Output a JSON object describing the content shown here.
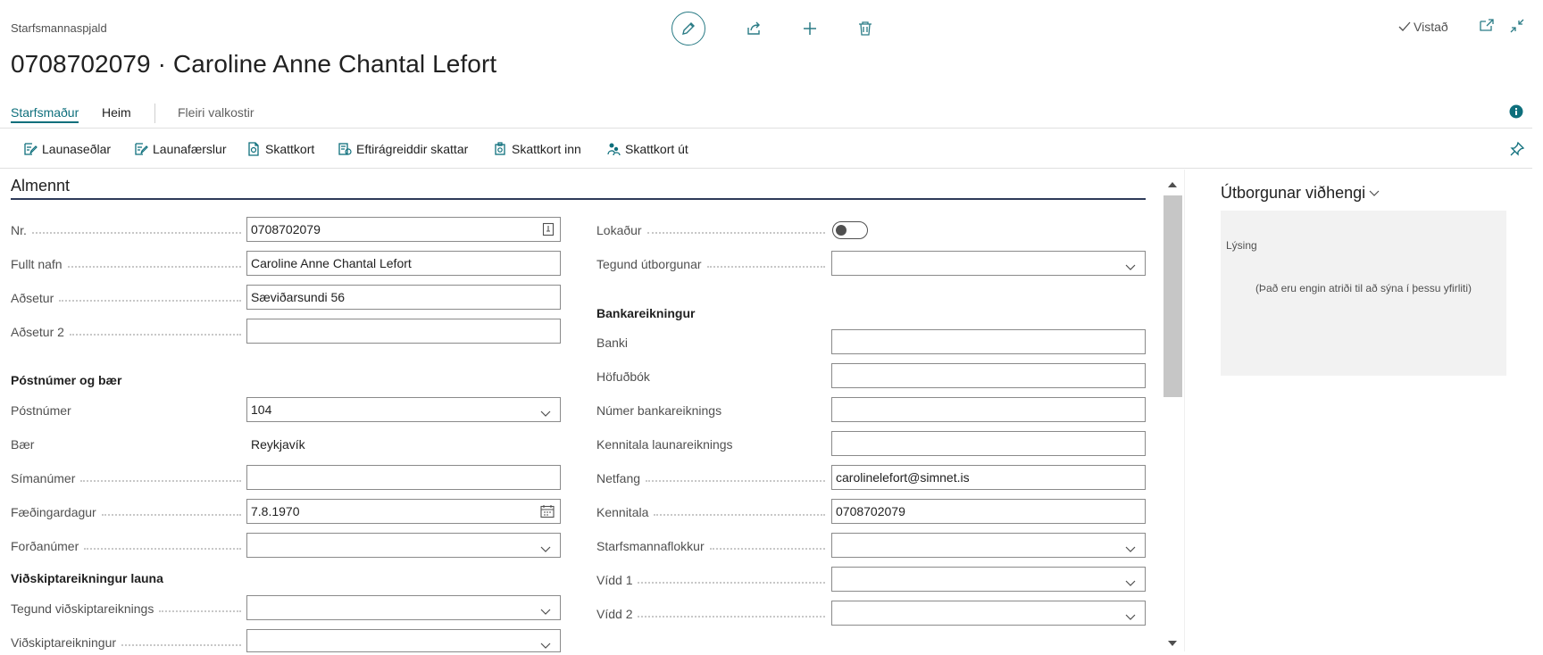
{
  "header": {
    "caption": "Starfsmannaspjald",
    "title": "0708702079 · Caroline Anne Chantal Lefort",
    "saved_label": "Vistað"
  },
  "tabs": [
    {
      "label": "Starfsmaður"
    },
    {
      "label": "Heim"
    },
    {
      "label": "Fleiri valkostir"
    }
  ],
  "actions": [
    {
      "label": "Launaseðlar"
    },
    {
      "label": "Launafærslur"
    },
    {
      "label": "Skattkort"
    },
    {
      "label": "Eftirágreiddir skattar"
    },
    {
      "label": "Skattkort inn"
    },
    {
      "label": "Skattkort út"
    }
  ],
  "section": {
    "title": "Almennt"
  },
  "left_fields": {
    "nr": {
      "label": "Nr.",
      "value": "0708702079"
    },
    "fullt_nafn": {
      "label": "Fullt nafn",
      "value": "Caroline Anne Chantal Lefort"
    },
    "adsetur": {
      "label": "Aðsetur",
      "value": "Sæviðarsundi 56"
    },
    "adsetur2": {
      "label": "Aðsetur 2",
      "value": ""
    },
    "group_postnumer": "Póstnúmer og bær",
    "postnumer": {
      "label": "Póstnúmer",
      "value": "104"
    },
    "baer": {
      "label": "Bær",
      "value": "Reykjavík"
    },
    "simanumer": {
      "label": "Símanúmer",
      "value": ""
    },
    "faedingardagur": {
      "label": "Fæðingardagur",
      "value": "7.8.1970"
    },
    "fordanumer": {
      "label": "Forðanúmer",
      "value": ""
    },
    "group_vidskipta": "Viðskiptareikningur launa",
    "tegund_vidskipta": {
      "label": "Tegund viðskiptareiknings",
      "value": ""
    },
    "vidskiptareikningur": {
      "label": "Viðskiptareikningur",
      "value": ""
    }
  },
  "right_fields": {
    "lokadur": {
      "label": "Lokaður",
      "value": false
    },
    "tegund_utborgunar": {
      "label": "Tegund útborgunar",
      "value": ""
    },
    "group_banka": "Bankareikningur",
    "banki": {
      "label": "Banki",
      "value": ""
    },
    "hofudbok": {
      "label": "Höfuðbók",
      "value": ""
    },
    "numer_banka": {
      "label": "Númer bankareiknings",
      "value": ""
    },
    "kennitala_launa": {
      "label": "Kennitala launareiknings",
      "value": ""
    },
    "netfang": {
      "label": "Netfang",
      "value": "carolinelefort@simnet.is"
    },
    "kennitala": {
      "label": "Kennitala",
      "value": "0708702079"
    },
    "starfsmannaflokkur": {
      "label": "Starfsmannaflokkur",
      "value": ""
    },
    "vidd1": {
      "label": "Vídd 1",
      "value": ""
    },
    "vidd2": {
      "label": "Vídd 2",
      "value": ""
    }
  },
  "factbox": {
    "title": "Útborgunar viðhengi",
    "column_header": "Lýsing",
    "empty_text": "(Það eru engin atriði til að sýna í þessu yfirliti)"
  },
  "colors": {
    "accent": "#0e6f7c",
    "section_line": "#2e3a59",
    "factbox_bg": "#f2f2f2"
  }
}
